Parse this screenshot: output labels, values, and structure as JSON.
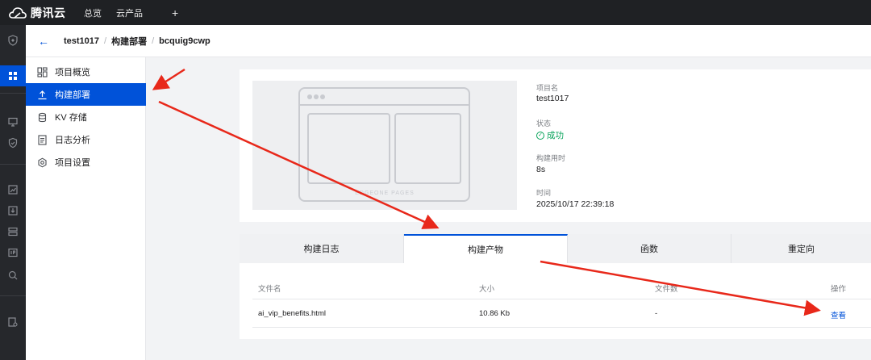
{
  "topbar": {
    "brand": "腾讯云",
    "nav": [
      "总览",
      "云产品"
    ],
    "plus": "+"
  },
  "breadcrumb": {
    "back": "←",
    "items": [
      "test1017",
      "构建部署",
      "bcquig9cwp"
    ]
  },
  "sidemenu": {
    "items": [
      {
        "label": "项目概览",
        "icon": "overview-icon"
      },
      {
        "label": "构建部署",
        "icon": "upload-icon",
        "active": true
      },
      {
        "label": "KV 存储",
        "icon": "database-icon"
      },
      {
        "label": "日志分析",
        "icon": "log-icon"
      },
      {
        "label": "项目设置",
        "icon": "settings-icon"
      }
    ]
  },
  "thumbnail": {
    "watermark": "EDGEONE PAGES"
  },
  "info": {
    "name_label": "项目名",
    "name_value": "test1017",
    "status_label": "状态",
    "status_value": "成功",
    "build_time_label": "构建用时",
    "build_time_value": "8s",
    "time_label": "时间",
    "time_value": "2025/10/17 22:39:18"
  },
  "tabs": [
    "构建日志",
    "构建产物",
    "函数",
    "重定向"
  ],
  "table": {
    "columns": [
      "文件名",
      "大小",
      "文件数",
      "操作"
    ],
    "rows": [
      {
        "filename": "ai_vip_benefits.html",
        "size": "10.86 Kb",
        "count": "-",
        "action": "查看"
      }
    ]
  },
  "colors": {
    "accent": "#0052d9",
    "success": "#07a35a",
    "annotation_arrow": "#e8281a"
  }
}
